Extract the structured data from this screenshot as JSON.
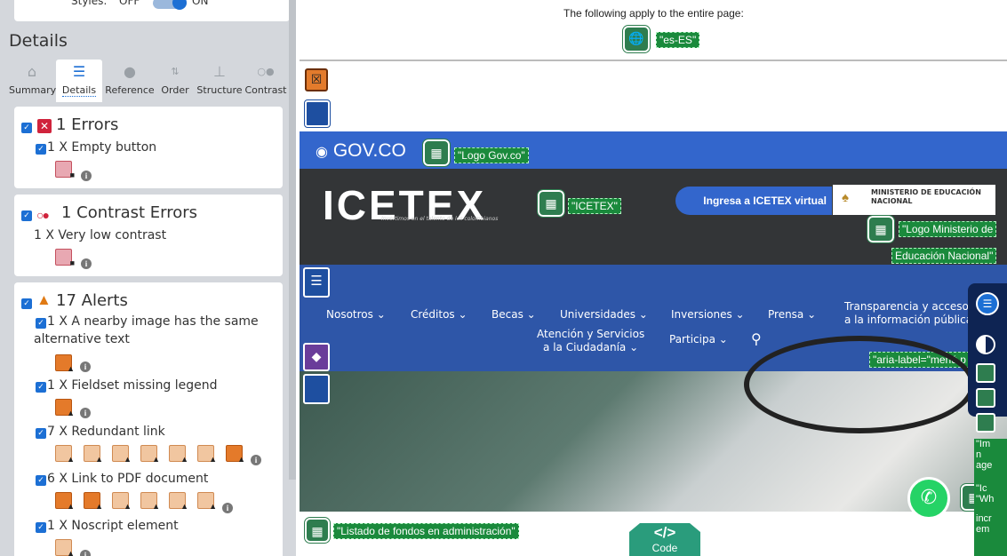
{
  "panel": {
    "styles_label": "Styles:",
    "styles_off": "OFF",
    "styles_on": "ON",
    "heading": "Details",
    "tabs": [
      {
        "label": "Summary",
        "icon": "home-icon"
      },
      {
        "label": "Details",
        "icon": "list-icon"
      },
      {
        "label": "Reference",
        "icon": "info-icon"
      },
      {
        "label": "Order",
        "icon": "order-icon"
      },
      {
        "label": "Structure",
        "icon": "structure-icon"
      },
      {
        "label": "Contrast",
        "icon": "contrast-icon"
      }
    ],
    "errors": {
      "title": "1 Errors",
      "items": [
        {
          "label": "1 X Empty button"
        }
      ]
    },
    "contrast": {
      "title": "1 Contrast Errors",
      "items": [
        {
          "label": "1 X Very low contrast"
        }
      ]
    },
    "alerts": {
      "title": "17 Alerts",
      "items": [
        {
          "label": "1 X A nearby image has the same",
          "label2": "alternative text"
        },
        {
          "label": "1 X Fieldset missing legend"
        },
        {
          "label": "7 X Redundant link"
        },
        {
          "label": "6 X Link to PDF document"
        },
        {
          "label": "1 X Noscript element"
        }
      ]
    }
  },
  "page": {
    "apply_text": "The following apply to the entire page:",
    "lang_label": "\"es-ES\"",
    "govco": "GOV.CO",
    "logo_govco": "\"Logo Gov.co\"",
    "icetex": "ICETEX",
    "icetex_tagline": "Invertimos en el talento de los colombianos",
    "icetex_label": "\"ICETEX\"",
    "ingresa": "Ingresa a ICETEX virtual",
    "ministerio": "MINISTERIO DE EDUCACIÓN",
    "nacional": "NACIONAL",
    "logo_min_1": "\"Logo Ministerio de",
    "logo_min_2": "Educación Nacional\"",
    "nav": [
      "Nosotros",
      "Créditos",
      "Becas",
      "Universidades",
      "Inversiones",
      "Prensa"
    ],
    "transparencia_1": "Transparencia y acceso",
    "transparencia_2": "a la información pública",
    "atencion_1": "Atención y Servicios",
    "atencion_2": "a la Ciudadanía",
    "participa": "Participa",
    "aria_label": "\"aria-label=\"menú p",
    "listado": "\"Listado de fondos en administración\"",
    "code_label": "Code",
    "code_symbol": "</>",
    "side_frag": [
      "\"Im",
      "n",
      "age",
      "\"Ic",
      "\"Wh",
      "incr",
      "em"
    ]
  }
}
